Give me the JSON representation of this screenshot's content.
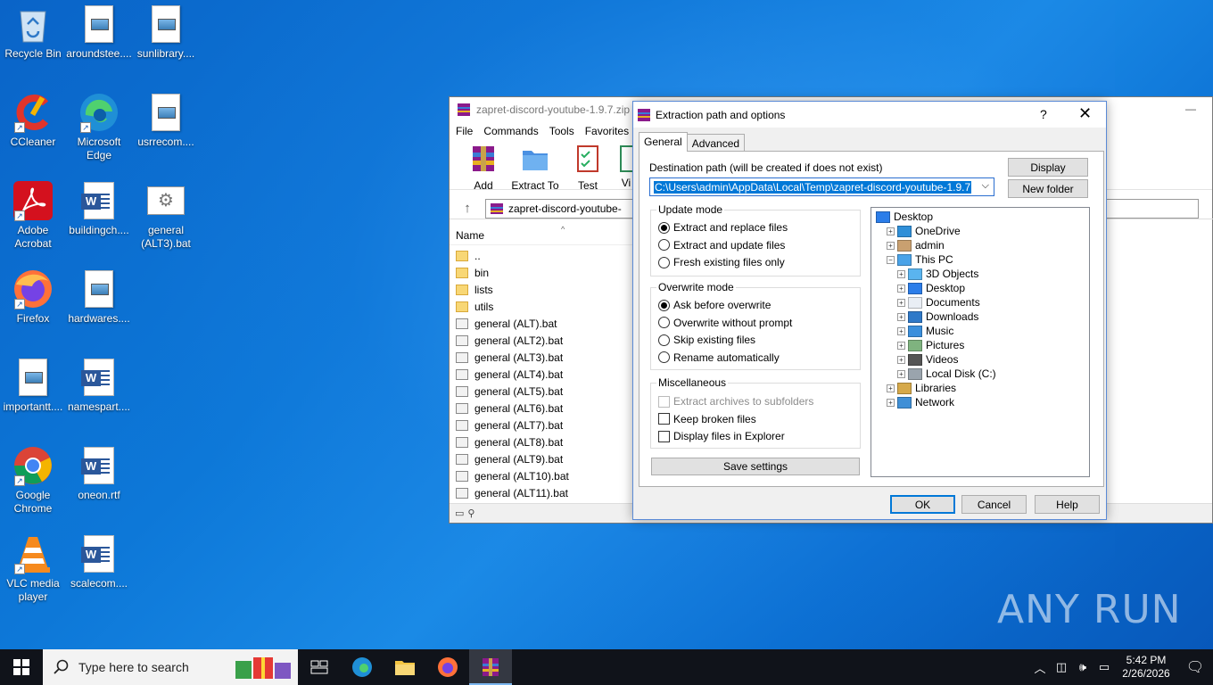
{
  "desktop": {
    "icons": [
      {
        "label": "Recycle Bin",
        "icon": "recycle-bin-icon"
      },
      {
        "label": "aroundstee....",
        "icon": "image-file-icon"
      },
      {
        "label": "sunlibrary....",
        "icon": "image-file-icon"
      },
      {
        "label": "CCleaner",
        "icon": "ccleaner-icon"
      },
      {
        "label": "Microsoft Edge",
        "icon": "edge-icon"
      },
      {
        "label": "usrrecom....",
        "icon": "image-file-icon"
      },
      {
        "label": "Adobe Acrobat",
        "icon": "acrobat-icon"
      },
      {
        "label": "buildingch....",
        "icon": "word-doc-icon"
      },
      {
        "label": "general (ALT3).bat",
        "icon": "bat-file-icon"
      },
      {
        "label": "Firefox",
        "icon": "firefox-icon"
      },
      {
        "label": "hardwares....",
        "icon": "image-file-icon"
      },
      {
        "label": "importantt....",
        "icon": "image-file-icon"
      },
      {
        "label": "namespart....",
        "icon": "word-doc-icon"
      },
      {
        "label": "Google Chrome",
        "icon": "chrome-icon"
      },
      {
        "label": "oneon.rtf",
        "icon": "word-doc-icon"
      },
      {
        "label": "VLC media player",
        "icon": "vlc-icon"
      },
      {
        "label": "scalecom....",
        "icon": "word-doc-icon"
      }
    ]
  },
  "winrar": {
    "title": "zapret-discord-youtube-1.9.7.zip",
    "menu": [
      "File",
      "Commands",
      "Tools",
      "Favorites"
    ],
    "toolbar": [
      "Add",
      "Extract To",
      "Test",
      "Vi"
    ],
    "address": "zapret-discord-youtube-",
    "column_name": "Name",
    "files": [
      {
        "name": "..",
        "type": "folder"
      },
      {
        "name": "bin",
        "type": "folder"
      },
      {
        "name": "lists",
        "type": "folder"
      },
      {
        "name": "utils",
        "type": "folder"
      },
      {
        "name": "general (ALT).bat",
        "type": "bat"
      },
      {
        "name": "general (ALT2).bat",
        "type": "bat"
      },
      {
        "name": "general (ALT3).bat",
        "type": "bat"
      },
      {
        "name": "general (ALT4).bat",
        "type": "bat"
      },
      {
        "name": "general (ALT5).bat",
        "type": "bat"
      },
      {
        "name": "general (ALT6).bat",
        "type": "bat"
      },
      {
        "name": "general (ALT7).bat",
        "type": "bat"
      },
      {
        "name": "general (ALT8).bat",
        "type": "bat"
      },
      {
        "name": "general (ALT9).bat",
        "type": "bat"
      },
      {
        "name": "general (ALT10).bat",
        "type": "bat"
      },
      {
        "name": "general (ALT11).bat",
        "type": "bat"
      }
    ]
  },
  "dialog": {
    "title": "Extraction path and options",
    "help_glyph": "?",
    "close_glyph": "✕",
    "tabs": [
      "General",
      "Advanced"
    ],
    "dest_label": "Destination path (will be created if does not exist)",
    "dest_value": "C:\\Users\\admin\\AppData\\Local\\Temp\\zapret-discord-youtube-1.9.7",
    "display_btn": "Display",
    "new_folder_btn": "New folder",
    "update_mode": {
      "title": "Update mode",
      "options": [
        "Extract and replace files",
        "Extract and update files",
        "Fresh existing files only"
      ],
      "selected": 0
    },
    "overwrite_mode": {
      "title": "Overwrite mode",
      "options": [
        "Ask before overwrite",
        "Overwrite without prompt",
        "Skip existing files",
        "Rename automatically"
      ],
      "selected": 0
    },
    "misc": {
      "title": "Miscellaneous",
      "options": [
        {
          "label": "Extract archives to subfolders",
          "checked": false,
          "disabled": true
        },
        {
          "label": "Keep broken files",
          "checked": false,
          "disabled": false
        },
        {
          "label": "Display files in Explorer",
          "checked": false,
          "disabled": false
        }
      ]
    },
    "save_settings": "Save settings",
    "tree": [
      {
        "label": "Desktop",
        "level": 0,
        "expander": "",
        "icon": "desktop-icon"
      },
      {
        "label": "OneDrive",
        "level": 1,
        "expander": "+",
        "icon": "onedrive-icon"
      },
      {
        "label": "admin",
        "level": 1,
        "expander": "+",
        "icon": "user-icon"
      },
      {
        "label": "This PC",
        "level": 1,
        "expander": "−",
        "icon": "pc-icon"
      },
      {
        "label": "3D Objects",
        "level": 2,
        "expander": "+",
        "icon": "3d-objects-icon"
      },
      {
        "label": "Desktop",
        "level": 2,
        "expander": "+",
        "icon": "desktop-icon"
      },
      {
        "label": "Documents",
        "level": 2,
        "expander": "+",
        "icon": "documents-icon"
      },
      {
        "label": "Downloads",
        "level": 2,
        "expander": "+",
        "icon": "downloads-icon"
      },
      {
        "label": "Music",
        "level": 2,
        "expander": "+",
        "icon": "music-icon"
      },
      {
        "label": "Pictures",
        "level": 2,
        "expander": "+",
        "icon": "pictures-icon"
      },
      {
        "label": "Videos",
        "level": 2,
        "expander": "+",
        "icon": "videos-icon"
      },
      {
        "label": "Local Disk (C:)",
        "level": 2,
        "expander": "+",
        "icon": "disk-icon"
      },
      {
        "label": "Libraries",
        "level": 1,
        "expander": "+",
        "icon": "libraries-icon"
      },
      {
        "label": "Network",
        "level": 1,
        "expander": "+",
        "icon": "network-icon"
      }
    ],
    "ok": "OK",
    "cancel": "Cancel",
    "help": "Help"
  },
  "taskbar": {
    "search_placeholder": "Type here to search",
    "time": "5:42 PM",
    "date": "2/26/2026"
  },
  "watermark": "ANY RUN"
}
